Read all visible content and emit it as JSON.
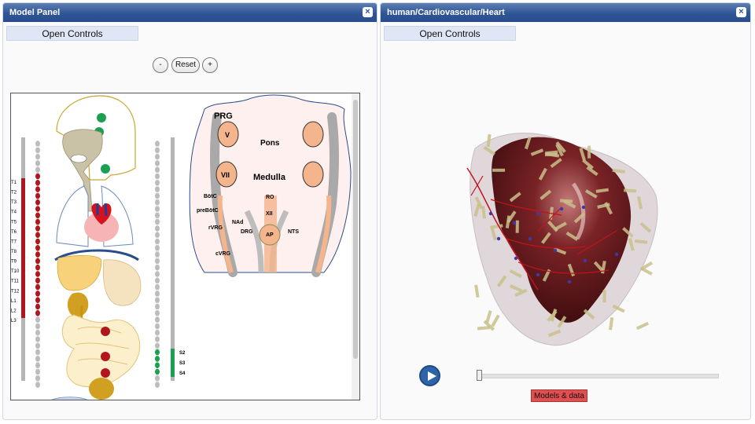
{
  "left_panel": {
    "title": "Model Panel",
    "close_icon": "close-icon",
    "open_controls_label": "Open Controls",
    "zoom_out_label": "-",
    "reset_label": "Reset",
    "zoom_in_label": "+",
    "diagram": {
      "thoracic_labels": [
        "T1",
        "T2",
        "T3",
        "T4",
        "T5",
        "T6",
        "T7",
        "T8",
        "T9",
        "T10",
        "T11",
        "T12",
        "L1",
        "L2",
        "L3"
      ],
      "sacral_labels": [
        "S2",
        "S3",
        "S4"
      ],
      "brainstem_labels": {
        "prg": "PRG",
        "v": "V",
        "pons": "Pons",
        "vii": "VII",
        "medulla": "Medulla",
        "botc": "BötC",
        "ro": "RO",
        "prebotc": "preBötC",
        "xii": "XII",
        "nad": "NAd",
        "rvrg": "rVRG",
        "drg": "DRG",
        "ap": "AP",
        "nts": "NTS",
        "cvrg": "cVRG"
      }
    }
  },
  "right_panel": {
    "title": "human/Cardiovascular/Heart",
    "close_icon": "close-icon",
    "open_controls_label": "Open Controls",
    "play_icon": "play-icon",
    "slider_value": 0,
    "models_data_label": "Models & data"
  },
  "colors": {
    "titlebar": "#2f5597",
    "spine_red": "#b0161b",
    "nerve_green": "#1aa050",
    "heart_muscle": "#6e1c1e",
    "models_button": "#e05050"
  }
}
